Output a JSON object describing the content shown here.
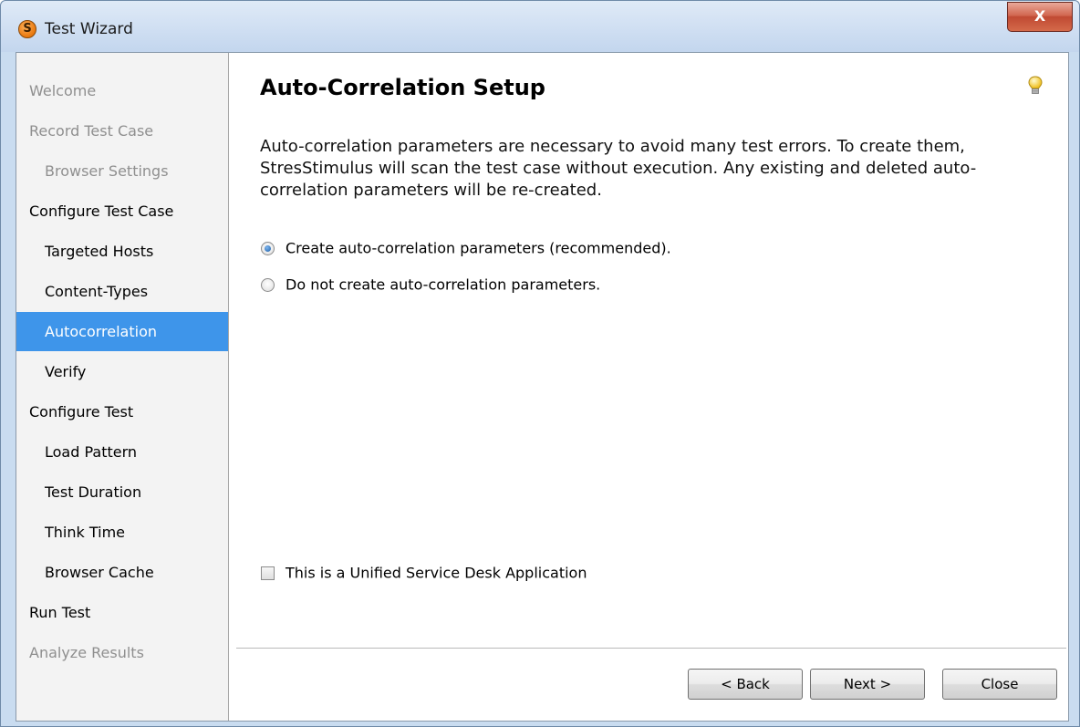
{
  "window": {
    "title": "Test Wizard",
    "app_icon_letter": "S",
    "close_glyph": "X",
    "accent_color": "#3e95ea"
  },
  "sidebar": {
    "items": [
      {
        "label": "Welcome",
        "level": 0,
        "state": "disabled"
      },
      {
        "label": "Record Test Case",
        "level": 0,
        "state": "disabled"
      },
      {
        "label": "Browser Settings",
        "level": 1,
        "state": "disabled"
      },
      {
        "label": "Configure Test Case",
        "level": 0,
        "state": "enabled"
      },
      {
        "label": "Targeted Hosts",
        "level": 1,
        "state": "enabled"
      },
      {
        "label": "Content-Types",
        "level": 1,
        "state": "enabled"
      },
      {
        "label": "Autocorrelation",
        "level": 1,
        "state": "selected"
      },
      {
        "label": "Verify",
        "level": 1,
        "state": "enabled"
      },
      {
        "label": "Configure Test",
        "level": 0,
        "state": "enabled"
      },
      {
        "label": "Load Pattern",
        "level": 1,
        "state": "enabled"
      },
      {
        "label": "Test Duration",
        "level": 1,
        "state": "enabled"
      },
      {
        "label": "Think Time",
        "level": 1,
        "state": "enabled"
      },
      {
        "label": "Browser Cache",
        "level": 1,
        "state": "enabled"
      },
      {
        "label": "Run Test",
        "level": 0,
        "state": "enabled"
      },
      {
        "label": "Analyze Results",
        "level": 0,
        "state": "disabled"
      }
    ]
  },
  "main": {
    "heading": "Auto-Correlation Setup",
    "hint_icon": "lightbulb-icon",
    "description": "Auto-correlation parameters are necessary to avoid many test errors. To create them, StresStimulus will scan the test case without execution. Any existing and deleted auto-correlation parameters will be re-created.",
    "options": [
      {
        "label": "Create auto-correlation parameters  (recommended).",
        "selected": true
      },
      {
        "label": "Do not create auto-correlation parameters.",
        "selected": false
      }
    ],
    "checkbox": {
      "label": "This is a Unified Service Desk Application",
      "checked": false
    }
  },
  "buttons": {
    "back": "< Back",
    "next": "Next >",
    "close": "Close"
  }
}
